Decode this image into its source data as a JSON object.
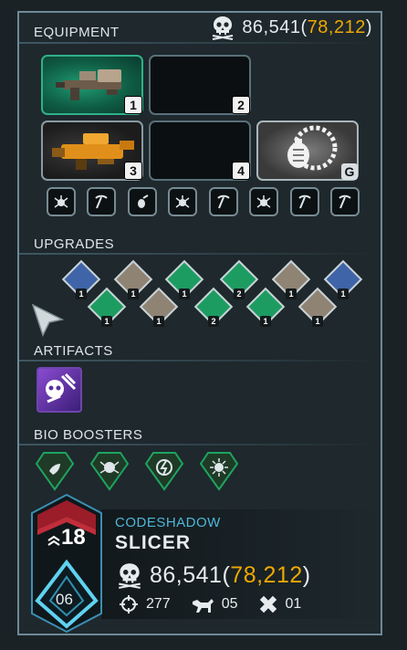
{
  "sections": {
    "equipment": "EQUIPMENT",
    "upgrades": "UPGRADES",
    "artifacts": "ARTIFACTS",
    "bio_boosters": "BIO BOOSTERS"
  },
  "currency": {
    "value": "86,541",
    "open": "(",
    "reserve": "78,212",
    "close": ")",
    "icon": "skull-icon"
  },
  "equipment_slots": [
    {
      "badge": "1",
      "state": "filled",
      "icon": "shotgun-icon",
      "style": "green"
    },
    {
      "badge": "2",
      "state": "empty"
    },
    {
      "badge": "3",
      "state": "filled",
      "icon": "heavy-rifle-icon",
      "style": "dark"
    },
    {
      "badge": "4",
      "state": "empty"
    },
    {
      "badge": "G",
      "state": "filled",
      "icon": "grenade-icon",
      "style": "white"
    }
  ],
  "mod_icons": [
    "bug-mod-icon",
    "pickaxe-mod-icon",
    "grenade-mod-icon",
    "bug-mod-icon",
    "pickaxe-mod-icon",
    "bug-mod-icon",
    "pickaxe-mod-icon",
    "pickaxe-mod-icon"
  ],
  "upgrades": [
    {
      "color": "blue",
      "level": "1"
    },
    {
      "color": "tan",
      "level": "1"
    },
    {
      "color": "green",
      "level": "1"
    },
    {
      "color": "green",
      "level": "2"
    },
    {
      "color": "tan",
      "level": "1"
    },
    {
      "color": "blue",
      "level": "1"
    },
    {
      "color": "green",
      "level": "1"
    },
    {
      "color": "tan",
      "level": "1"
    },
    {
      "color": "green",
      "level": "2"
    },
    {
      "color": "green",
      "level": "1"
    },
    {
      "color": "tan",
      "level": "1"
    }
  ],
  "artifact": {
    "icon": "skull-artifact-icon"
  },
  "bio_boosters": [
    "leaf-booster-icon",
    "bug-booster-icon",
    "lightning-booster-icon",
    "sun-booster-icon"
  ],
  "player": {
    "level": "18",
    "rank": "06",
    "username": "CODESHADOW",
    "class_name": "SLICER",
    "kills": "277",
    "dogs": "05",
    "revives": "01"
  },
  "colors": {
    "accent_gold": "#f0a800",
    "accent_cyan": "#4eb7d9",
    "upgrade_blue": "#3f64a8",
    "upgrade_green": "#1d9c62",
    "upgrade_tan": "#8f8374"
  }
}
